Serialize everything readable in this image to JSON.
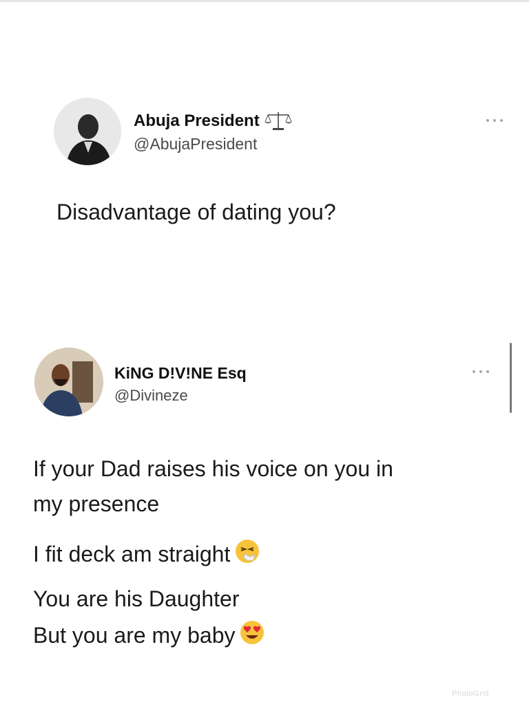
{
  "tweet1": {
    "display_name": "Abuja President",
    "handle": "@AbujaPresident",
    "text": "Disadvantage of dating you?",
    "badge_icon": "scales-icon"
  },
  "tweet2": {
    "display_name": "KiNG D!V!NE Esq",
    "handle": "@Divineze",
    "lines": [
      "If your Dad raises his voice on you in",
      "my presence",
      "I fit deck am straight",
      "You are his Daughter",
      "But you are my baby"
    ],
    "emoji_icons": [
      "sneezing-face-emoji-icon",
      "heart-eyes-emoji-icon"
    ]
  },
  "watermark": "PhotoGrid",
  "colors": {
    "text": "#1a1a1a",
    "handle": "#4a4a4a",
    "more_dots": "#a8a8a8"
  }
}
